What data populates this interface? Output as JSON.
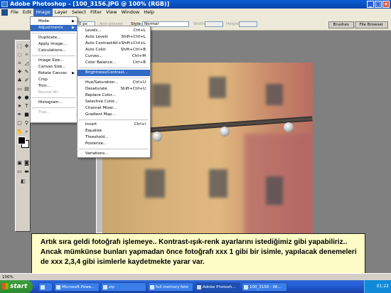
{
  "window": {
    "title": "Adobe Photoshop - [100_3156.JPG @ 100% (RGB)]"
  },
  "menubar": {
    "items": [
      "File",
      "Edit",
      "Image",
      "Layer",
      "Select",
      "Filter",
      "View",
      "Window",
      "Help"
    ],
    "active": "Image"
  },
  "options": {
    "feather_value": "0 px",
    "antialiased": "Anti-aliased",
    "style_label": "Style:",
    "style_value": "Normal",
    "width_label": "Width:",
    "height_label": "Height:"
  },
  "panel_tabs": [
    "Brushes",
    "File Browser"
  ],
  "image_menu": [
    {
      "label": "Mode",
      "submenu": true
    },
    {
      "label": "Adjustments",
      "submenu": true,
      "highlighted": true
    },
    {
      "label": "Duplicate..."
    },
    {
      "label": "Apply Image..."
    },
    {
      "label": "Calculations..."
    },
    {
      "label": "Image Size..."
    },
    {
      "label": "Canvas Size..."
    },
    {
      "label": "Rotate Canvas",
      "submenu": true
    },
    {
      "label": "Crop"
    },
    {
      "label": "Trim..."
    },
    {
      "label": "Reveal All",
      "disabled": true
    },
    {
      "label": "Histogram..."
    },
    {
      "label": "Trap...",
      "disabled": true
    }
  ],
  "adjustments_menu": [
    {
      "label": "Levels...",
      "shortcut": "Ctrl+L"
    },
    {
      "label": "Auto Levels",
      "shortcut": "Shift+Ctrl+L"
    },
    {
      "label": "Auto Contrast",
      "shortcut": "Alt+Shift+Ctrl+L"
    },
    {
      "label": "Auto Color",
      "shortcut": "Shift+Ctrl+B"
    },
    {
      "label": "Curves...",
      "shortcut": "Ctrl+M"
    },
    {
      "label": "Color Balance...",
      "shortcut": "Ctrl+B"
    },
    {
      "label": "Brightness/Contrast...",
      "shortcut": "",
      "highlighted": true
    },
    {
      "label": "Hue/Saturation...",
      "shortcut": "Ctrl+U"
    },
    {
      "label": "Desaturate",
      "shortcut": "Shift+Ctrl+U"
    },
    {
      "label": "Replace Color...",
      "shortcut": ""
    },
    {
      "label": "Selective Color...",
      "shortcut": ""
    },
    {
      "label": "Channel Mixer...",
      "shortcut": ""
    },
    {
      "label": "Gradient Map...",
      "shortcut": ""
    },
    {
      "label": "Invert",
      "shortcut": "Ctrl+I"
    },
    {
      "label": "Equalize",
      "shortcut": ""
    },
    {
      "label": "Threshold...",
      "shortcut": ""
    },
    {
      "label": "Posterize...",
      "shortcut": ""
    },
    {
      "label": "Variations...",
      "shortcut": ""
    }
  ],
  "caption": {
    "text": "Artık sıra geldi fotoğrafı işlemeye.. Kontrast-ışık-renk ayarlarını istediğimiz gibi yapabiliriz.. Ancak mümkünse bunları yapmadan önce fotoğrafı xxx 1 gibi bir isimle, yapılacak denemeleri de xxx 2,3,4 gibi isimlerle kaydetmekte yarar var."
  },
  "status": {
    "zoom": "100%"
  },
  "taskbar": {
    "start": "start",
    "tasks": [
      "",
      "Microsoft Powe...",
      "zip",
      "full memory foto",
      "Adobe Photosh...",
      "100_3156 - Wi..."
    ],
    "clock": "01:22"
  }
}
